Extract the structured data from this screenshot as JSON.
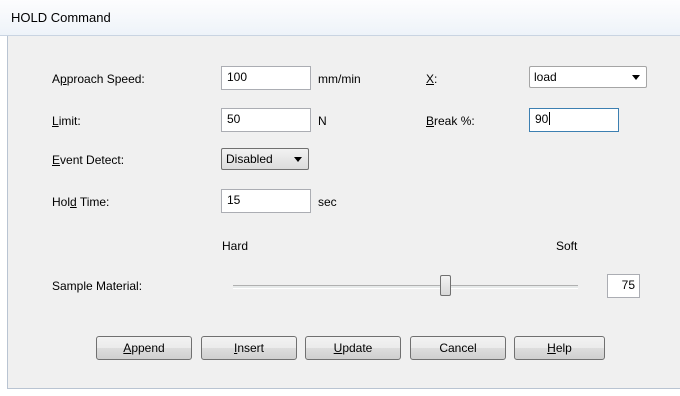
{
  "window": {
    "title": "HOLD Command"
  },
  "fields": {
    "approach_speed": {
      "label_pre": "A",
      "label_u": "p",
      "label_post": "proach Speed:",
      "value": "100",
      "unit": "mm/min"
    },
    "limit": {
      "label_pre": "",
      "label_u": "L",
      "label_post": "imit:",
      "value": "50",
      "unit": "N"
    },
    "event_detect": {
      "label_pre": "",
      "label_u": "E",
      "label_post": "vent Detect:",
      "value": "Disabled"
    },
    "hold_time": {
      "label_pre": "Hol",
      "label_u": "d",
      "label_post": " Time:",
      "value": "15",
      "unit": "sec"
    },
    "x": {
      "label_pre": "",
      "label_u": "X",
      "label_post": ":",
      "value": "load"
    },
    "break_pct": {
      "label_pre": "",
      "label_u": "B",
      "label_post": "reak %:",
      "value": "90"
    }
  },
  "sample_material": {
    "label": "Sample Material:",
    "min_label": "Hard",
    "max_label": "Soft",
    "value": "75",
    "level": 0.75
  },
  "buttons": {
    "append": {
      "pre": "",
      "u": "A",
      "post": "ppend"
    },
    "insert": {
      "pre": "",
      "u": "I",
      "post": "nsert"
    },
    "update": {
      "pre": "",
      "u": "U",
      "post": "pdate"
    },
    "cancel": {
      "pre": "Cancel",
      "u": "",
      "post": ""
    },
    "help": {
      "pre": "",
      "u": "H",
      "post": "elp"
    }
  }
}
